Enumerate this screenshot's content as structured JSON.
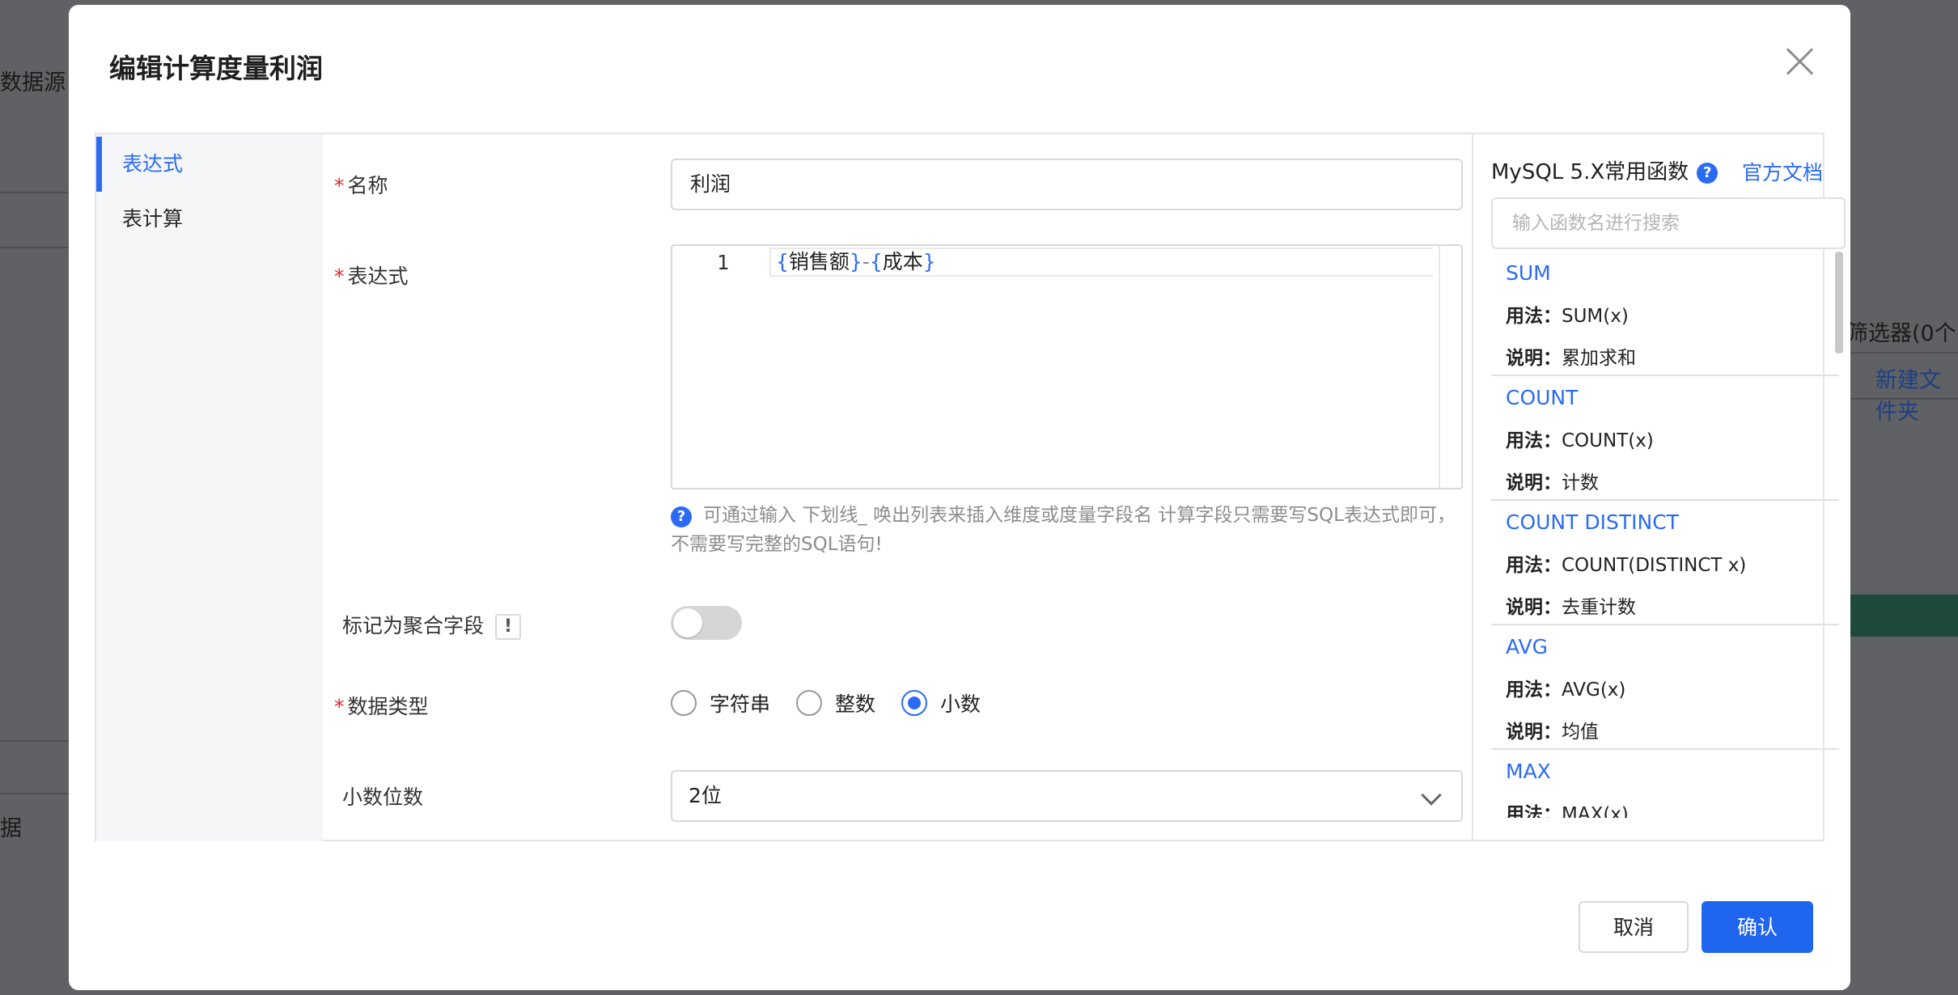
{
  "background": {
    "left_labels": [
      "数据源",
      "据"
    ],
    "right_labels": [
      "筛选器(0个",
      "新建文件夹"
    ]
  },
  "modal": {
    "title": "编辑计算度量利润",
    "close_icon": "close-icon"
  },
  "nav": {
    "items": [
      {
        "label": "表达式",
        "active": true
      },
      {
        "label": "表计算",
        "active": false
      }
    ]
  },
  "form": {
    "name": {
      "label": "名称",
      "required": true,
      "value": "利润"
    },
    "expression": {
      "label": "表达式",
      "required": true,
      "line_number": "1",
      "code": {
        "field1": "销售额",
        "operator": "-",
        "field2": "成本"
      },
      "hint": "可通过输入 下划线_ 唤出列表来插入维度或度量字段名 计算字段只需要写SQL表达式即可，不需要写完整的SQL语句!"
    },
    "aggregate": {
      "label": "标记为聚合字段",
      "badge": "!",
      "enabled": false
    },
    "data_type": {
      "label": "数据类型",
      "required": true,
      "options": [
        {
          "label": "字符串",
          "checked": false
        },
        {
          "label": "整数",
          "checked": false
        },
        {
          "label": "小数",
          "checked": true
        }
      ]
    },
    "decimals": {
      "label": "小数位数",
      "value": "2位"
    }
  },
  "functions": {
    "title": "MySQL 5.X常用函数",
    "doc_link": "官方文档",
    "search_placeholder": "输入函数名进行搜索",
    "usage_key": "用法：",
    "desc_key": "说明：",
    "items": [
      {
        "name": "SUM",
        "usage": "SUM(x)",
        "desc": "累加求和"
      },
      {
        "name": "COUNT",
        "usage": "COUNT(x)",
        "desc": "计数"
      },
      {
        "name": "COUNT DISTINCT",
        "usage": "COUNT(DISTINCT x)",
        "desc": "去重计数"
      },
      {
        "name": "AVG",
        "usage": "AVG(x)",
        "desc": "均值"
      },
      {
        "name": "MAX",
        "usage": "MAX(x)",
        "desc": ""
      }
    ]
  },
  "footer": {
    "cancel": "取消",
    "confirm": "确认"
  },
  "colors": {
    "accent": "#2b6bf3",
    "required": "#e0262b"
  }
}
